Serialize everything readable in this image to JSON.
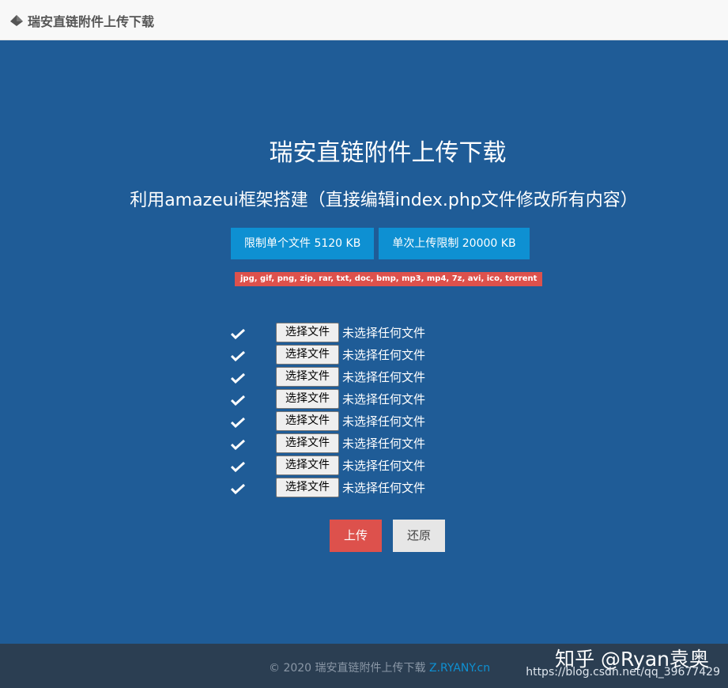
{
  "header": {
    "brand_text": "瑞安直链附件上传下载",
    "logo_icon": "diamond-logo-icon"
  },
  "hero": {
    "title": "瑞安直链附件上传下载",
    "subtitle": "利用amazeui框架搭建（直接编辑index.php文件修改所有内容）",
    "limit_single": "限制单个文件 5120 KB",
    "limit_total": "单次上传限制 20000 KB",
    "allowed_types": "jpg, gif, png, zip, rar, txt, doc, bmp, mp3, mp4, 7z, avi, ico, torrent"
  },
  "file_rows": [
    {
      "button": "选择文件",
      "status": "未选择任何文件"
    },
    {
      "button": "选择文件",
      "status": "未选择任何文件"
    },
    {
      "button": "选择文件",
      "status": "未选择任何文件"
    },
    {
      "button": "选择文件",
      "status": "未选择任何文件"
    },
    {
      "button": "选择文件",
      "status": "未选择任何文件"
    },
    {
      "button": "选择文件",
      "status": "未选择任何文件"
    },
    {
      "button": "选择文件",
      "status": "未选择任何文件"
    },
    {
      "button": "选择文件",
      "status": "未选择任何文件"
    }
  ],
  "actions": {
    "upload": "上传",
    "reset": "还原"
  },
  "footer": {
    "copyright": "© 2020 瑞安直链附件上传下载",
    "link": "Z.RYANY.cn"
  },
  "watermark": {
    "line1": "知乎 @Ryan袁奥",
    "line2": "https://blog.csdn.net/qq_39677429"
  },
  "colors": {
    "hero_bg": "#1f5c97",
    "limit_btn": "#0e90d2",
    "danger": "#dd514c",
    "footer_bg": "#2b3e52"
  }
}
